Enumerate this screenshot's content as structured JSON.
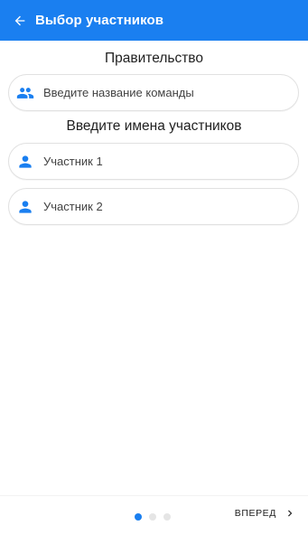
{
  "header": {
    "title": "Выбор участников",
    "back_icon": "arrow-left-icon",
    "bg_color": "#1a7ff0"
  },
  "team": {
    "section_title": "Правительство",
    "placeholder": "Введите название команды",
    "icon": "people-icon"
  },
  "participants": {
    "section_title": "Введите имена участников",
    "fields": [
      {
        "placeholder": "Участник 1",
        "icon": "person-icon"
      },
      {
        "placeholder": "Участник 2",
        "icon": "person-icon"
      }
    ]
  },
  "footer": {
    "pages": 3,
    "current_page": 1,
    "next_label": "ВПЕРЕД",
    "next_icon": "chevron-right-icon"
  }
}
